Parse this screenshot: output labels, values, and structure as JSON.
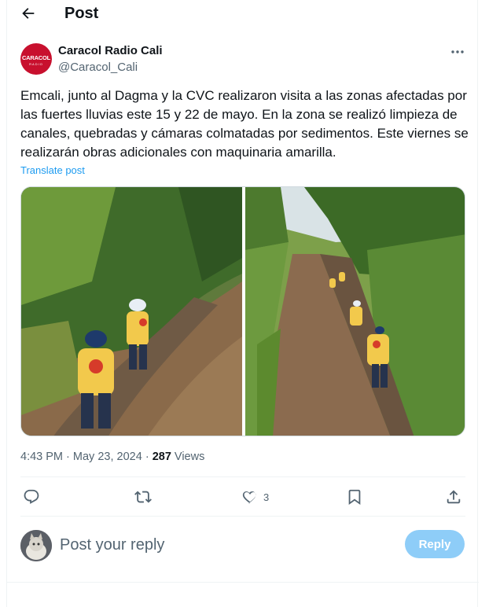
{
  "header": {
    "title": "Post"
  },
  "author": {
    "display_name": "Caracol Radio Cali",
    "handle": "@Caracol_Cali",
    "avatar_logo": "CARACOL",
    "avatar_sub": "RADIO",
    "brand_color": "#c8102e"
  },
  "post": {
    "text": "Emcali, junto al Dagma y la CVC realizaron visita a las zonas afectadas por las fuertes lluvias este 15 y 22 de mayo. En la zona se realizó limpieza de canales, quebradas y cámaras colmatadas por sedimentos. Este viernes se realizarán obras adicionales con maquinaria amarilla.",
    "translate_label": "Translate post",
    "time": "4:43 PM",
    "date": "May 23, 2024",
    "views_count": "287",
    "views_label": "Views",
    "separator": "·"
  },
  "actions": {
    "reply_icon": "reply-icon",
    "repost_icon": "repost-icon",
    "like_icon": "heart-icon",
    "like_count": "3",
    "bookmark_icon": "bookmark-icon",
    "share_icon": "share-icon"
  },
  "reply_box": {
    "placeholder": "Post your reply",
    "button_label": "Reply"
  },
  "colors": {
    "accent": "#1d9bf0",
    "reply_button_disabled": "#8ecdf8",
    "secondary_text": "#536471"
  }
}
